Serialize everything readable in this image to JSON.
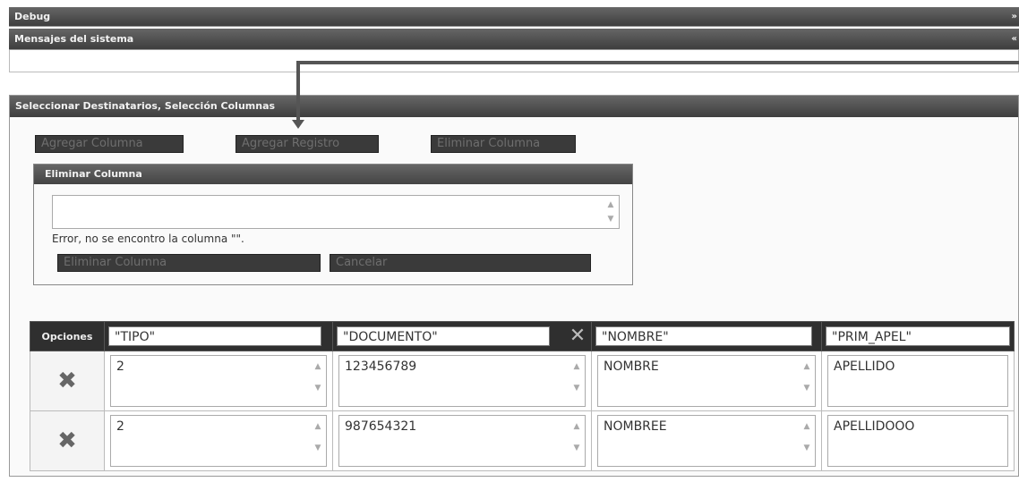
{
  "bars": {
    "debug": "Debug",
    "debug_arrow": "»",
    "messages": "Mensajes del sistema",
    "messages_arrow": "«"
  },
  "panel": {
    "title": "Seleccionar Destinatarios, Selección Columnas",
    "buttons": {
      "add_column": "Agregar Columna",
      "add_record": "Agregar Registro",
      "delete_column": "Eliminar Columna"
    }
  },
  "dialog": {
    "title": "Eliminar Columna",
    "text_value": "",
    "error": "Error, no se encontro la columna \"\".",
    "delete_button": "Eliminar Columna",
    "cancel_button": "Cancelar"
  },
  "table": {
    "options_header": "Opciones",
    "columns": [
      "\"TIPO\"",
      "\"DOCUMENTO\"",
      "\"NOMBRE\"",
      "\"PRIM_APEL\""
    ],
    "rows": [
      [
        "2",
        "123456789",
        "NOMBRE",
        "APELLIDO"
      ],
      [
        "2",
        "987654321",
        "NOMBREE",
        "APELLIDOOO"
      ]
    ]
  },
  "icons": {
    "close": "✕",
    "delete_row": "✖",
    "scroll_up": "▲",
    "scroll_down": "▼"
  }
}
